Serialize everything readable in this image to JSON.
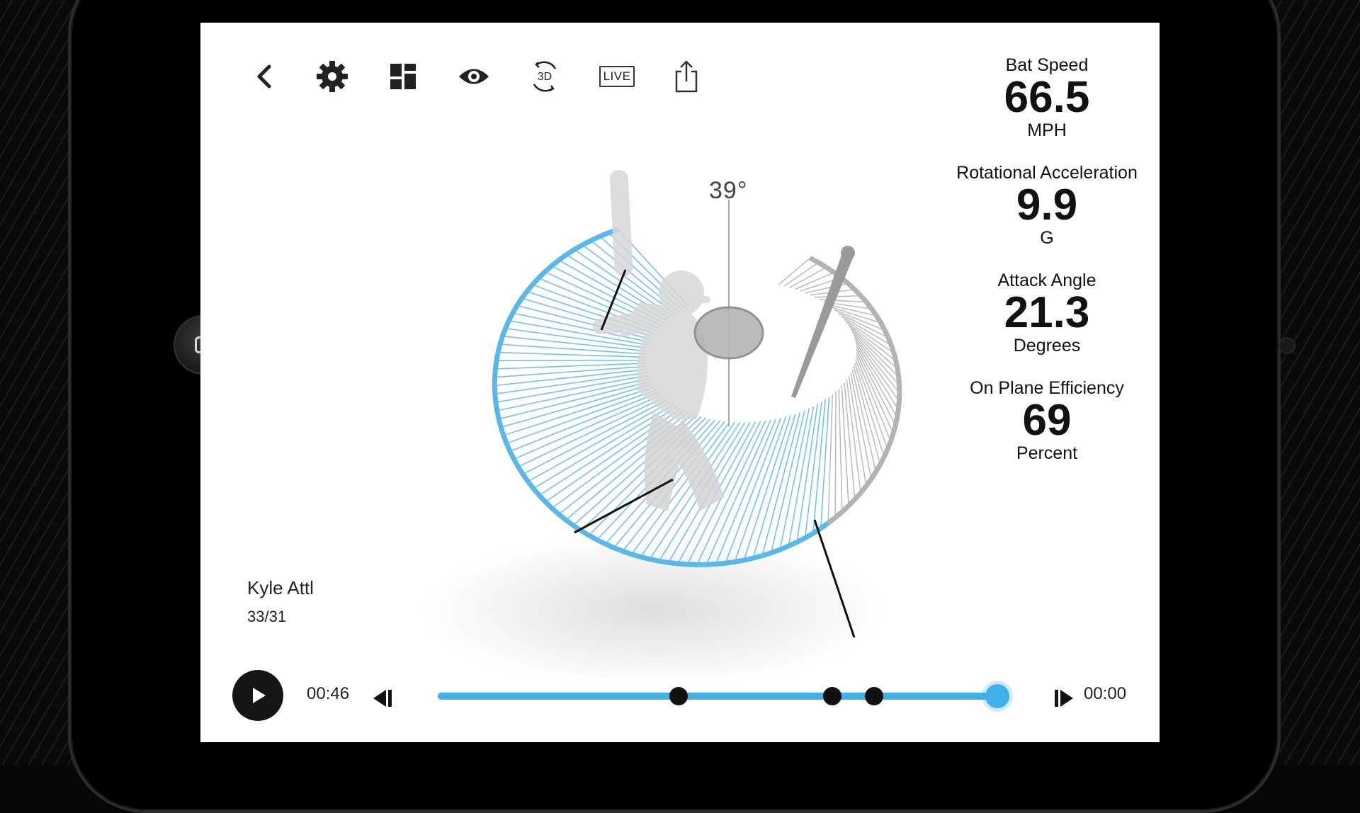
{
  "toolbar": {
    "back_icon": "chevron-left-icon",
    "settings_icon": "gear-icon",
    "dashboard_icon": "grid-icon",
    "view_icon": "eye-icon",
    "rotate3d_icon": "rotate-3d-icon",
    "rotate3d_label": "3D",
    "live_label": "LIVE",
    "share_icon": "share-icon"
  },
  "metrics": [
    {
      "label": "Bat Speed",
      "value": "66.5",
      "unit": "MPH"
    },
    {
      "label": "Rotational Acceleration",
      "value": "9.9",
      "unit": "G"
    },
    {
      "label": "Attack Angle",
      "value": "21.3",
      "unit": "Degrees"
    },
    {
      "label": "On Plane Efficiency",
      "value": "69",
      "unit": "Percent"
    }
  ],
  "visualization": {
    "angle_label": "39°",
    "colors": {
      "on_plane": "#5ab8e8",
      "off_plane": "#b3b3b3",
      "silhouette": "#d8d8d8"
    }
  },
  "player": {
    "name": "Kyle Attl",
    "swing_count": "33/31"
  },
  "playback": {
    "elapsed": "00:46",
    "remaining": "00:00",
    "progress": 1.0,
    "marker_fractions": [
      0.43,
      0.705,
      0.78
    ],
    "accent": "#3fb0ea"
  }
}
